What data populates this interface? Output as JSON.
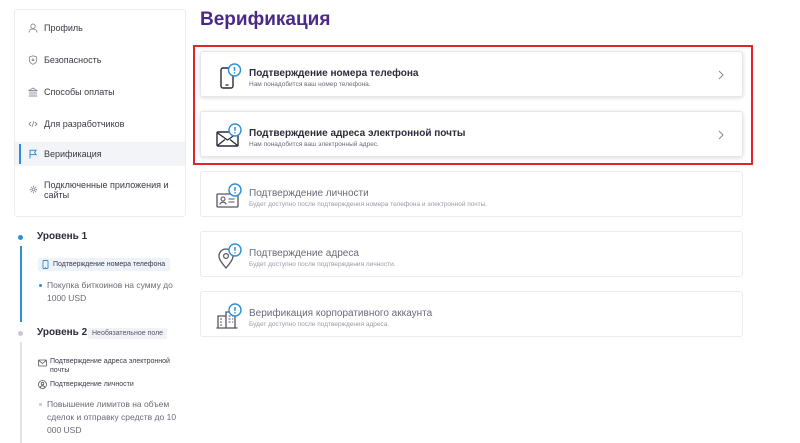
{
  "nav": {
    "items": [
      {
        "label": "Профиль",
        "icon": "user-icon"
      },
      {
        "label": "Безопасность",
        "icon": "shield-icon"
      },
      {
        "label": "Способы оплаты",
        "icon": "bank-icon"
      },
      {
        "label": "Для разработчиков",
        "icon": "code-icon"
      },
      {
        "label": "Верификация",
        "icon": "flag-icon"
      },
      {
        "label": "Подключенные приложения и сайты",
        "icon": "gear-icon"
      }
    ]
  },
  "levels": {
    "level1": {
      "title": "Уровень 1",
      "requirement": "Подтверждение номера телефона",
      "benefit": "Покупка биткоинов на сумму до 1000 USD"
    },
    "level2": {
      "title": "Уровень 2",
      "badge": "Необязательное поле",
      "requirements": [
        "Подтверждение адреса электронной почты",
        "Подтверждение личности"
      ],
      "benefit": "Повышение лимитов на объем сделок и отправку средств до 10 000 USD"
    }
  },
  "main": {
    "title": "Верификация",
    "cards": [
      {
        "title": "Подтверждение номера телефона",
        "subtitle": "Нам понадобится ваш номер телефона.",
        "icon": "phone-icon"
      },
      {
        "title": "Подтверждение адреса электронной почты",
        "subtitle": "Нам понадобится ваш электронный адрес.",
        "icon": "mail-icon"
      },
      {
        "title": "Подтверждение личности",
        "subtitle": "Будет доступно после подтверждения номера телефона и электронной почты.",
        "icon": "id-card-icon"
      },
      {
        "title": "Подтверждение адреса",
        "subtitle": "Будет доступно после подтверждения личности.",
        "icon": "location-icon"
      },
      {
        "title": "Верификация корпоративного аккаунта",
        "subtitle": "Будет доступно после подтверждения адреса.",
        "icon": "building-icon"
      }
    ]
  },
  "colors": {
    "accent": "#2a8fd6",
    "title": "#4a2a86",
    "highlight": "#e0252b"
  }
}
